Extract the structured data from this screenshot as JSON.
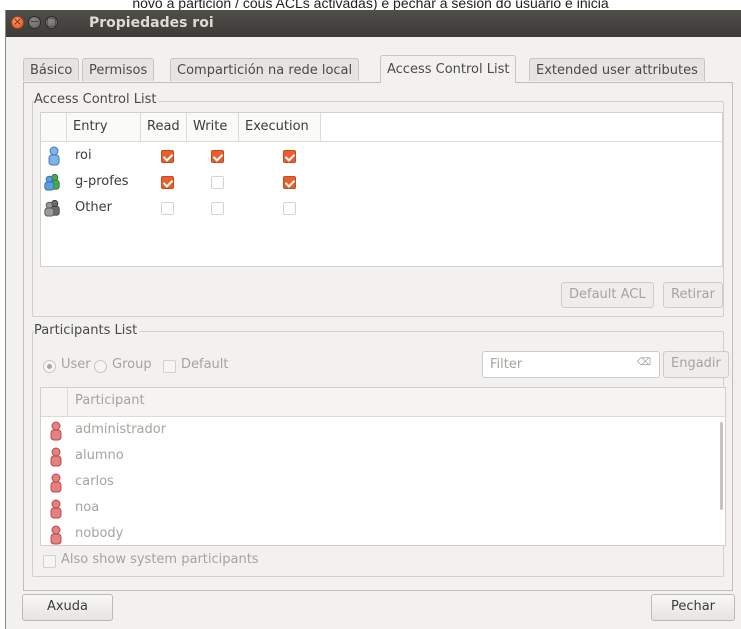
{
  "background_caption": "novo a partición / cous ACLs activadas) e pechar a sesión do usuario e inicia",
  "window": {
    "title": "Propiedades roi"
  },
  "tabs": [
    "Básico",
    "Permisos",
    "Compartición na rede local",
    "Access Control List",
    "Extended user attributes"
  ],
  "active_tab": "Access Control List",
  "acl": {
    "frame_label": "Access Control List",
    "columns": [
      "Entry",
      "Read",
      "Write",
      "Execution"
    ],
    "rows": [
      {
        "entry": "roi",
        "icon": "user-icon",
        "read": true,
        "write": true,
        "execution": true
      },
      {
        "entry": "g-profes",
        "icon": "group-icon",
        "read": true,
        "write": false,
        "execution": true
      },
      {
        "entry": "Other",
        "icon": "other-icon",
        "read": false,
        "write": false,
        "execution": false
      }
    ],
    "default_acl_label": "Default ACL",
    "remove_label": "Retirar"
  },
  "participants": {
    "frame_label": "Participants List",
    "radio_user": "User",
    "radio_group": "Group",
    "default_label": "Default",
    "filter_placeholder": "Filter",
    "filter_clear": "⌫",
    "add_label": "Engadir",
    "column": "Participant",
    "items": [
      "administrador",
      "alumno",
      "carlos",
      "noa",
      "nobody"
    ],
    "show_system_label": "Also show system participants"
  },
  "buttons": {
    "help": "Axuda",
    "close": "Pechar"
  }
}
